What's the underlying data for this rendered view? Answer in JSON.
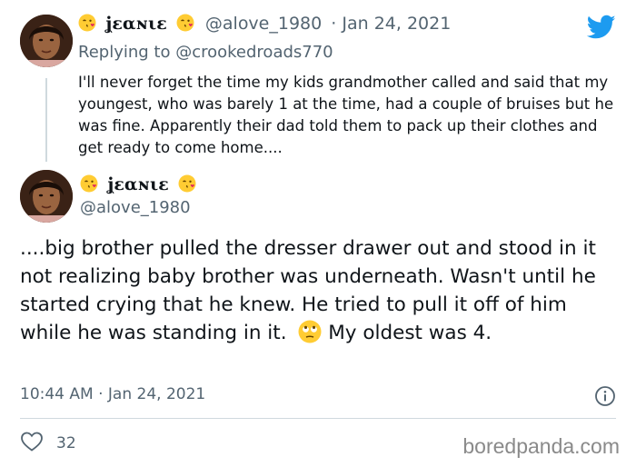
{
  "reply_tweet": {
    "display_name": "ʝɛαɴιɛ",
    "handle": "@alove_1980",
    "date": "· Jan 24, 2021",
    "replying_prefix": "Replying to",
    "replying_to": "@crookedroads770",
    "body": "I'll never forget the time my kids grandmother called and said that my youngest, who was barely 1 at the time, had a couple of bruises but he was fine. Apparently their dad told them to pack up their clothes and get ready to come home...."
  },
  "main_tweet": {
    "display_name": "ʝɛαɴιɛ",
    "handle": "@alove_1980",
    "body_part1": "....big brother pulled the dresser drawer out and stood in it not realizing baby brother was underneath. Wasn't until he started crying that he knew. He tried to pull it off of him while he was standing in it.",
    "body_part2": " My oldest was 4.",
    "timestamp": "10:44 AM · Jan 24, 2021",
    "like_count": "32"
  },
  "icons": {
    "name_emoji": "face-blowing-kiss-emoji",
    "body_emoji": "face-with-rolling-eyes-emoji",
    "brand": "twitter-bird-icon",
    "info": "info-icon",
    "like": "heart-icon"
  },
  "colors": {
    "twitter_blue": "#1d9bf0",
    "text": "#0f1419",
    "secondary_text": "#536471",
    "divider": "#cfd9de"
  },
  "watermark": "boredpanda.com"
}
